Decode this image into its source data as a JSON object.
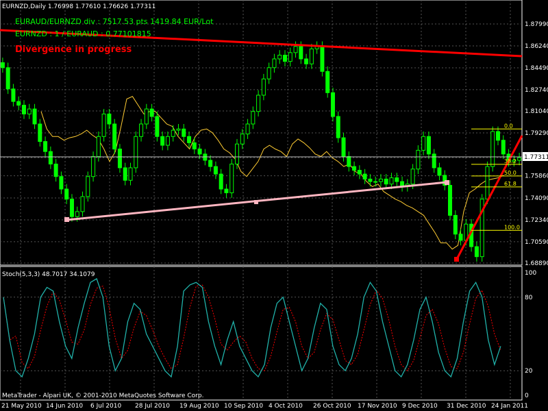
{
  "symbol_header": "EURNZD,Daily  1.76998 1.77610 1.76626 1.77311",
  "overlay_line1": "EURAUD/EURNZD div : 7517.53 pts 1419.84 EUR/Lot",
  "overlay_line2": "EURNZD : 1 / EURAUD : 0.77101815",
  "overlay_warning": "Divergence in progress",
  "indicator_header": "Stoch(5,3,3) 48.7017 34.1079",
  "copyright": "MetaTrader - Alpari UK, © 2001-2010 MetaQuotes Software Corp.",
  "colors": {
    "background": "#000000",
    "bull_candle": "#00ff00",
    "overlay_text": "#00ff00",
    "warning_text": "#ff0000",
    "secondary_series": "#ffcc33",
    "trendline_upper": "#ff0000",
    "trendline_lower": "#ffb6c1",
    "fibonacci": "#ffff00",
    "stoch_main": "#20b2aa",
    "stoch_signal": "#ff0000"
  },
  "price_axis_labels": [
    "1.87990",
    "1.86240",
    "1.84490",
    "1.82740",
    "1.81040",
    "1.79290",
    "1.77311",
    "1.75860",
    "1.74090",
    "1.72340",
    "1.70590",
    "1.68890"
  ],
  "stoch_axis_labels": [
    "100",
    "80",
    "20",
    "0"
  ],
  "date_axis_labels": [
    "21 May 2010",
    "14 Jun 2010",
    "6 Jul 2010",
    "28 Jul 2010",
    "19 Aug 2010",
    "10 Sep 2010",
    "4 Oct 2010",
    "26 Oct 2010",
    "17 Nov 2010",
    "9 Dec 2010",
    "31 Dec 2010",
    "24 Jan 2011"
  ],
  "fib_levels": [
    {
      "label": "0.0",
      "price": 1.796
    },
    {
      "label": "38.2",
      "price": 1.7678
    },
    {
      "label": "50.0",
      "price": 1.7585
    },
    {
      "label": "61.8",
      "price": 1.7497
    },
    {
      "label": "100.0",
      "price": 1.715
    }
  ],
  "current_price": 1.77311,
  "chart_data": {
    "type": "candlestick",
    "series": [
      {
        "values": [
          1.845,
          1.828,
          1.818,
          1.815,
          1.808,
          1.812,
          1.8,
          1.786,
          1.778,
          1.768,
          1.758,
          1.748,
          1.74,
          1.726,
          1.73,
          1.742,
          1.758,
          1.774,
          1.79,
          1.808,
          1.8,
          1.78,
          1.765,
          1.755,
          1.765,
          1.79,
          1.8,
          1.812,
          1.806,
          1.79,
          1.783,
          1.79,
          1.795,
          1.796,
          1.79,
          1.785,
          1.78,
          1.776,
          1.771,
          1.766,
          1.76,
          1.748,
          1.745,
          1.768,
          1.784,
          1.792,
          1.8,
          1.81,
          1.823,
          1.836,
          1.845,
          1.852,
          1.855,
          1.85,
          1.857,
          1.862,
          1.852,
          1.848,
          1.86,
          1.862,
          1.842,
          1.825,
          1.806,
          1.789,
          1.774,
          1.766,
          1.763,
          1.76,
          1.756,
          1.754,
          1.754,
          1.756,
          1.752,
          1.757,
          1.754,
          1.75,
          1.752,
          1.764,
          1.779,
          1.79,
          1.776,
          1.765,
          1.759,
          1.751,
          1.727,
          1.712,
          1.707,
          1.72,
          1.702,
          1.694,
          1.74,
          1.766,
          1.794,
          1.787,
          1.776,
          1.77,
          1.771,
          1.773
        ]
      },
      {
        "values": [
          1.81,
          1.796,
          1.79,
          1.79,
          1.787,
          1.789,
          1.79,
          1.792,
          1.795,
          1.791,
          1.788,
          1.78,
          1.77,
          1.778,
          1.798,
          1.82,
          1.822,
          1.815,
          1.808,
          1.81,
          1.81,
          1.805,
          1.8,
          1.798,
          1.79,
          1.785,
          1.78,
          1.79,
          1.795,
          1.796,
          1.793,
          1.787,
          1.78,
          1.777,
          1.772,
          1.762,
          1.758,
          1.764,
          1.77,
          1.78,
          1.783,
          1.78,
          1.778,
          1.774,
          1.784,
          1.788,
          1.785,
          1.781,
          1.776,
          1.774,
          1.778,
          1.773,
          1.77,
          1.766,
          1.768,
          1.762,
          1.76,
          1.754,
          1.75,
          1.752,
          1.746,
          1.743,
          1.74,
          1.738,
          1.735,
          1.733,
          1.73,
          1.727,
          1.72,
          1.713,
          1.705,
          1.705,
          1.7,
          1.703,
          1.73,
          1.745,
          1.748,
          1.752,
          1.755,
          1.756,
          1.757,
          1.759
        ]
      },
      {
        "values": [
          80,
          45,
          20,
          15,
          30,
          50,
          80,
          88,
          85,
          60,
          40,
          30,
          55,
          75,
          92,
          95,
          80,
          40,
          20,
          30,
          60,
          75,
          70,
          50,
          40,
          30,
          20,
          15,
          40,
          85,
          90,
          92,
          88,
          60,
          40,
          25,
          45,
          60,
          40,
          30,
          20,
          15,
          25,
          55,
          75,
          80,
          60,
          40,
          20,
          30,
          55,
          75,
          70,
          40,
          25,
          20,
          30,
          50,
          80,
          92,
          85,
          60,
          40,
          20,
          15,
          25,
          45,
          70,
          80,
          60,
          35,
          20,
          15,
          30,
          60,
          85,
          92,
          80,
          45,
          25,
          40
        ]
      }
    ]
  }
}
